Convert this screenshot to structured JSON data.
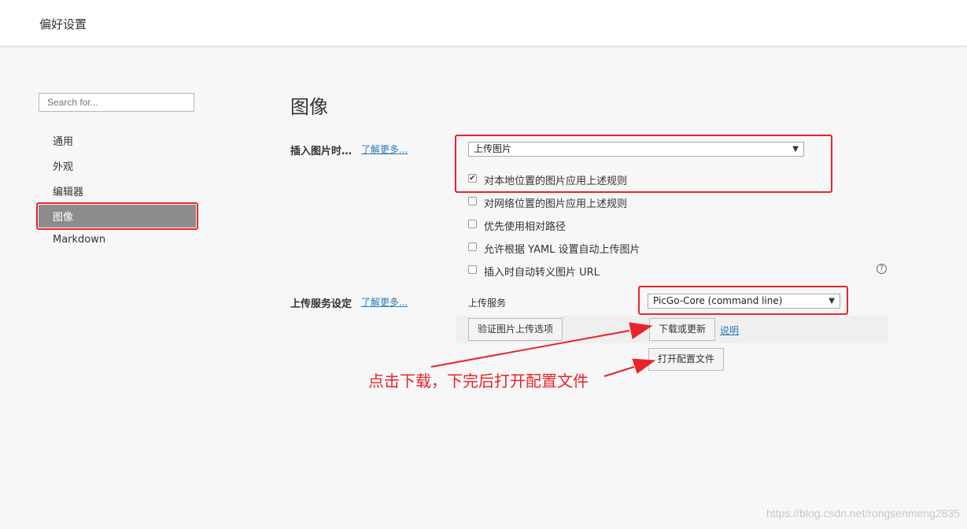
{
  "window": {
    "title": "偏好设置"
  },
  "sidebar": {
    "search_placeholder": "Search for...",
    "items": [
      {
        "label": "通用"
      },
      {
        "label": "外观"
      },
      {
        "label": "编辑器"
      },
      {
        "label": "图像",
        "active": true
      },
      {
        "label": "Markdown"
      }
    ]
  },
  "main": {
    "title": "图像",
    "insert_section": {
      "label": "插入图片时…",
      "learn_more": "了解更多...",
      "select_value": "上传图片",
      "options": [
        {
          "label": "对本地位置的图片应用上述规则",
          "checked": true
        },
        {
          "label": "对网络位置的图片应用上述规则",
          "checked": false
        },
        {
          "label": "优先使用相对路径",
          "checked": false
        },
        {
          "label": "允许根据 YAML 设置自动上传图片",
          "checked": false
        },
        {
          "label": "插入时自动转义图片 URL",
          "checked": false
        }
      ]
    },
    "upload_section": {
      "label": "上传服务设定",
      "learn_more": "了解更多...",
      "service_label": "上传服务",
      "service_value": "PicGo-Core (command line)",
      "verify_button": "验证图片上传选项",
      "download_button": "下载或更新",
      "doc_link": "说明",
      "open_config_button": "打开配置文件"
    }
  },
  "annotation": {
    "text": "点击下载，下完后打开配置文件",
    "color": "#e8242a"
  },
  "watermark": "https://blog.csdn.net/rongsenmeng2835",
  "colors": {
    "accent_red": "#e8242a",
    "link": "#2a7ab8",
    "active_nav": "#8c8c8c"
  }
}
